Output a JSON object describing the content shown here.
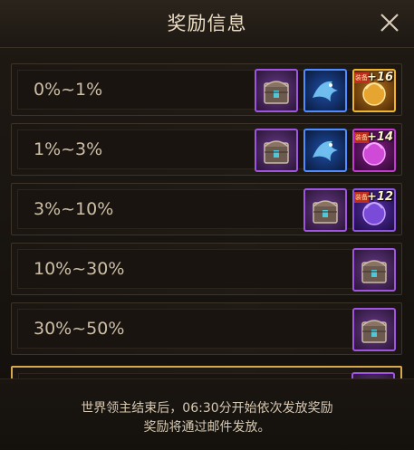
{
  "dialog": {
    "title": "奖励信息"
  },
  "rewards": [
    {
      "range": "0%~1%",
      "items": [
        {
          "icon": "treasure-chest-icon",
          "frame": "purple"
        },
        {
          "icon": "blue-wyvern-icon",
          "frame": "blue"
        },
        {
          "icon": "gold-orb-icon",
          "frame": "gold",
          "plus": "+16",
          "tag": "装备"
        }
      ]
    },
    {
      "range": "1%~3%",
      "items": [
        {
          "icon": "treasure-chest-icon",
          "frame": "purple"
        },
        {
          "icon": "blue-wyvern-icon",
          "frame": "blue"
        },
        {
          "icon": "magenta-orb-icon",
          "frame": "magenta",
          "plus": "+14",
          "tag": "装备"
        }
      ]
    },
    {
      "range": "3%~10%",
      "items": [
        {
          "icon": "treasure-chest-icon",
          "frame": "purple"
        },
        {
          "icon": "violet-orb-icon",
          "frame": "violet",
          "plus": "+12",
          "tag": "装备"
        }
      ]
    },
    {
      "range": "10%~30%",
      "items": [
        {
          "icon": "treasure-chest-icon",
          "frame": "purple"
        }
      ]
    },
    {
      "range": "30%~50%",
      "items": [
        {
          "icon": "treasure-chest-icon",
          "frame": "purple"
        }
      ]
    },
    {
      "range": "",
      "items": [
        {
          "icon": "treasure-chest-icon",
          "frame": "purple"
        }
      ]
    }
  ],
  "footer": {
    "line1": "世界领主结束后，06:30分开始依次发放奖励",
    "line2": "奖励将通过邮件发放。"
  },
  "colors": {
    "title": "#ecdcc2",
    "highlight_border": "#d9a84b"
  }
}
